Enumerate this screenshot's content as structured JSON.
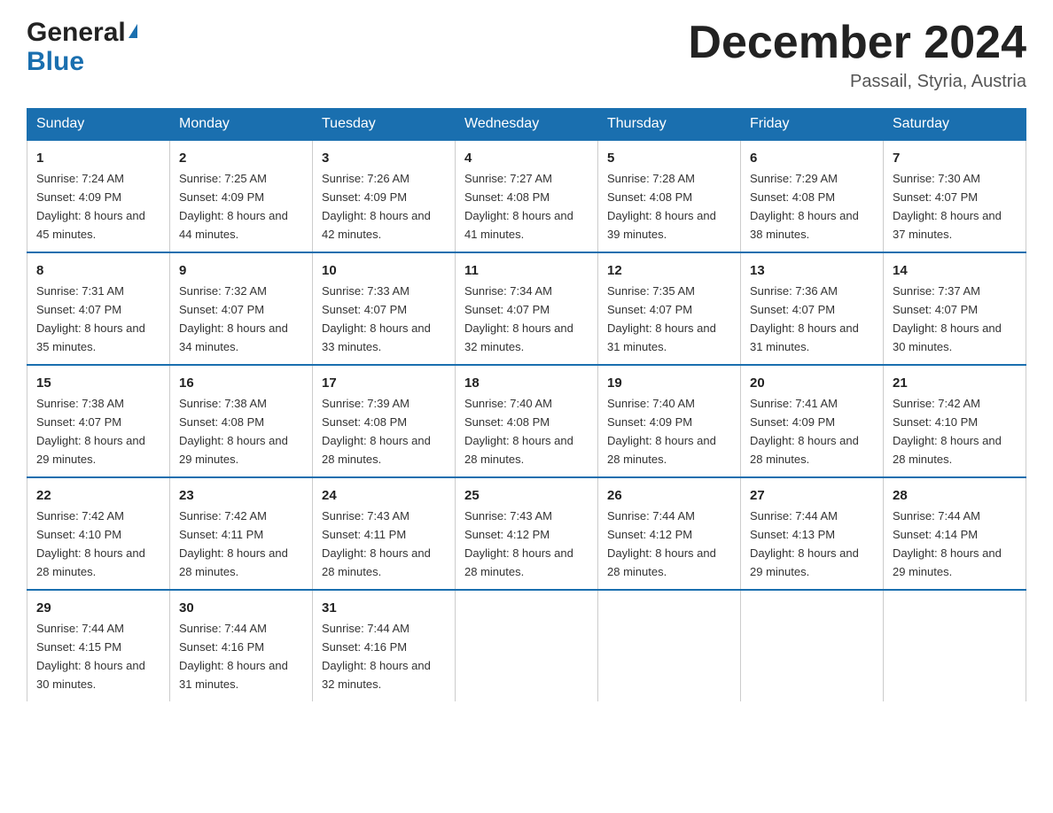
{
  "header": {
    "logo_general": "General",
    "logo_blue": "Blue",
    "month_title": "December 2024",
    "location": "Passail, Styria, Austria"
  },
  "days_of_week": [
    "Sunday",
    "Monday",
    "Tuesday",
    "Wednesday",
    "Thursday",
    "Friday",
    "Saturday"
  ],
  "weeks": [
    [
      {
        "day": "1",
        "sunrise": "7:24 AM",
        "sunset": "4:09 PM",
        "daylight": "8 hours and 45 minutes."
      },
      {
        "day": "2",
        "sunrise": "7:25 AM",
        "sunset": "4:09 PM",
        "daylight": "8 hours and 44 minutes."
      },
      {
        "day": "3",
        "sunrise": "7:26 AM",
        "sunset": "4:09 PM",
        "daylight": "8 hours and 42 minutes."
      },
      {
        "day": "4",
        "sunrise": "7:27 AM",
        "sunset": "4:08 PM",
        "daylight": "8 hours and 41 minutes."
      },
      {
        "day": "5",
        "sunrise": "7:28 AM",
        "sunset": "4:08 PM",
        "daylight": "8 hours and 39 minutes."
      },
      {
        "day": "6",
        "sunrise": "7:29 AM",
        "sunset": "4:08 PM",
        "daylight": "8 hours and 38 minutes."
      },
      {
        "day": "7",
        "sunrise": "7:30 AM",
        "sunset": "4:07 PM",
        "daylight": "8 hours and 37 minutes."
      }
    ],
    [
      {
        "day": "8",
        "sunrise": "7:31 AM",
        "sunset": "4:07 PM",
        "daylight": "8 hours and 35 minutes."
      },
      {
        "day": "9",
        "sunrise": "7:32 AM",
        "sunset": "4:07 PM",
        "daylight": "8 hours and 34 minutes."
      },
      {
        "day": "10",
        "sunrise": "7:33 AM",
        "sunset": "4:07 PM",
        "daylight": "8 hours and 33 minutes."
      },
      {
        "day": "11",
        "sunrise": "7:34 AM",
        "sunset": "4:07 PM",
        "daylight": "8 hours and 32 minutes."
      },
      {
        "day": "12",
        "sunrise": "7:35 AM",
        "sunset": "4:07 PM",
        "daylight": "8 hours and 31 minutes."
      },
      {
        "day": "13",
        "sunrise": "7:36 AM",
        "sunset": "4:07 PM",
        "daylight": "8 hours and 31 minutes."
      },
      {
        "day": "14",
        "sunrise": "7:37 AM",
        "sunset": "4:07 PM",
        "daylight": "8 hours and 30 minutes."
      }
    ],
    [
      {
        "day": "15",
        "sunrise": "7:38 AM",
        "sunset": "4:07 PM",
        "daylight": "8 hours and 29 minutes."
      },
      {
        "day": "16",
        "sunrise": "7:38 AM",
        "sunset": "4:08 PM",
        "daylight": "8 hours and 29 minutes."
      },
      {
        "day": "17",
        "sunrise": "7:39 AM",
        "sunset": "4:08 PM",
        "daylight": "8 hours and 28 minutes."
      },
      {
        "day": "18",
        "sunrise": "7:40 AM",
        "sunset": "4:08 PM",
        "daylight": "8 hours and 28 minutes."
      },
      {
        "day": "19",
        "sunrise": "7:40 AM",
        "sunset": "4:09 PM",
        "daylight": "8 hours and 28 minutes."
      },
      {
        "day": "20",
        "sunrise": "7:41 AM",
        "sunset": "4:09 PM",
        "daylight": "8 hours and 28 minutes."
      },
      {
        "day": "21",
        "sunrise": "7:42 AM",
        "sunset": "4:10 PM",
        "daylight": "8 hours and 28 minutes."
      }
    ],
    [
      {
        "day": "22",
        "sunrise": "7:42 AM",
        "sunset": "4:10 PM",
        "daylight": "8 hours and 28 minutes."
      },
      {
        "day": "23",
        "sunrise": "7:42 AM",
        "sunset": "4:11 PM",
        "daylight": "8 hours and 28 minutes."
      },
      {
        "day": "24",
        "sunrise": "7:43 AM",
        "sunset": "4:11 PM",
        "daylight": "8 hours and 28 minutes."
      },
      {
        "day": "25",
        "sunrise": "7:43 AM",
        "sunset": "4:12 PM",
        "daylight": "8 hours and 28 minutes."
      },
      {
        "day": "26",
        "sunrise": "7:44 AM",
        "sunset": "4:12 PM",
        "daylight": "8 hours and 28 minutes."
      },
      {
        "day": "27",
        "sunrise": "7:44 AM",
        "sunset": "4:13 PM",
        "daylight": "8 hours and 29 minutes."
      },
      {
        "day": "28",
        "sunrise": "7:44 AM",
        "sunset": "4:14 PM",
        "daylight": "8 hours and 29 minutes."
      }
    ],
    [
      {
        "day": "29",
        "sunrise": "7:44 AM",
        "sunset": "4:15 PM",
        "daylight": "8 hours and 30 minutes."
      },
      {
        "day": "30",
        "sunrise": "7:44 AM",
        "sunset": "4:16 PM",
        "daylight": "8 hours and 31 minutes."
      },
      {
        "day": "31",
        "sunrise": "7:44 AM",
        "sunset": "4:16 PM",
        "daylight": "8 hours and 32 minutes."
      },
      {
        "day": "",
        "sunrise": "",
        "sunset": "",
        "daylight": ""
      },
      {
        "day": "",
        "sunrise": "",
        "sunset": "",
        "daylight": ""
      },
      {
        "day": "",
        "sunrise": "",
        "sunset": "",
        "daylight": ""
      },
      {
        "day": "",
        "sunrise": "",
        "sunset": "",
        "daylight": ""
      }
    ]
  ],
  "labels": {
    "sunrise_prefix": "Sunrise: ",
    "sunset_prefix": "Sunset: ",
    "daylight_prefix": "Daylight: "
  }
}
